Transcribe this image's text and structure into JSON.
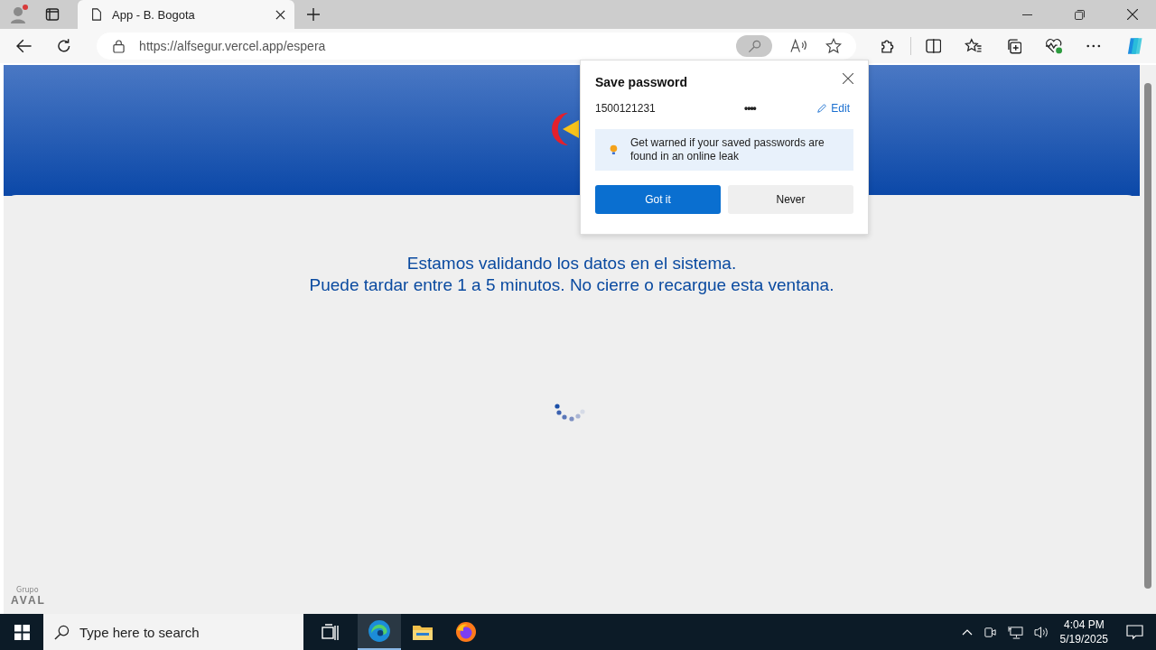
{
  "browser": {
    "tabs": [
      {
        "title": "App - B. Bogota",
        "selected": true
      }
    ],
    "url": "https://alfsegur.vercel.app/espera"
  },
  "page": {
    "messages": [
      "Estamos validando los datos en el sistema.",
      "Puede tardar entre 1 a 5 minutos. No cierre o recargue esta ventana."
    ],
    "footer_logo": {
      "small": "Grupo",
      "name": "AVAL"
    }
  },
  "save_password_popup": {
    "title": "Save password",
    "username": "1500121231",
    "password": "••••",
    "edit": "Edit",
    "notice": "Get warned if your saved passwords are found in an online leak",
    "buttons": [
      {
        "label": "Got it",
        "kind": "primary"
      },
      {
        "label": "Never",
        "kind": "secondary"
      }
    ]
  },
  "taskbar": {
    "search": {
      "placeholder": "Type here to search"
    },
    "time": "4:04 PM",
    "date": "5/19/2025"
  }
}
